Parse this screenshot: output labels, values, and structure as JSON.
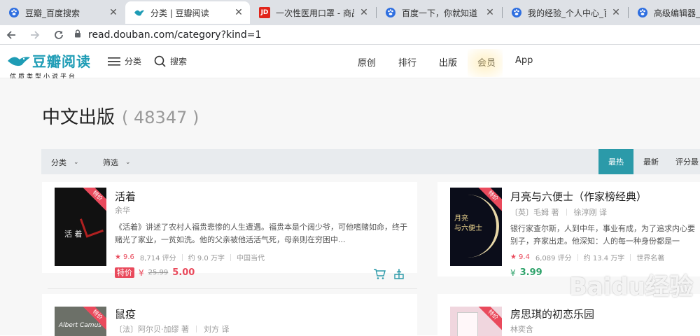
{
  "browser": {
    "tabs": [
      {
        "title": "豆瓣_百度搜索",
        "favicon": "baidu-paw-icon",
        "active": false
      },
      {
        "title": "分类 | 豆瓣阅读",
        "favicon": "douban-read-icon",
        "active": true
      },
      {
        "title": "一次性医用口罩 - 商品搜",
        "favicon": "jd-icon",
        "active": false
      },
      {
        "title": "百度一下，你就知道",
        "favicon": "baidu-paw-icon",
        "active": false
      },
      {
        "title": "我的经验_个人中心_百度",
        "favicon": "baidu-paw-icon",
        "active": false
      },
      {
        "title": "高级编辑器_百度",
        "favicon": "baidu-paw-icon",
        "active": false
      }
    ],
    "jd_favicon_text": "JD",
    "url": "read.douban.com/category?kind=1"
  },
  "site": {
    "brand": "豆瓣阅读",
    "slogan": "优质类型小说平台",
    "category_link": "分类",
    "search_link": "搜索",
    "nav": [
      "原创",
      "排行",
      "出版",
      "会员",
      "App"
    ]
  },
  "page": {
    "title": "中文出版",
    "count": "( 48347 )"
  },
  "filters": {
    "category": "分类",
    "filter": "筛选",
    "sort": [
      {
        "label": "最热",
        "active": true
      },
      {
        "label": "最新",
        "active": false
      },
      {
        "label": "评分最",
        "active": false
      }
    ]
  },
  "books": [
    {
      "title": "活着",
      "author": "余华",
      "ribbon": "特价",
      "cover_text": "活 着",
      "description": "《活着》讲述了农村人福贵悲惨的人生遭遇。福贵本是个阔少爷，可他嗜赌如命，终于赌光了家业，一贫如洗。他的父亲被他活活气死，母亲则在穷困中...",
      "rating": "9.6",
      "rating_count": "8,714 评分",
      "words": "约 9.0 万字",
      "genre": "中国当代",
      "price_tag": "特价",
      "currency": "¥",
      "old_price": "25.99",
      "price": "5.00"
    },
    {
      "title": "月亮与六便士（作家榜经典）",
      "author": "〔英〕毛姆 著",
      "translator": "徐淳刚 译",
      "ribbon": "特价",
      "cover_text": "月亮\n与六便士",
      "description": "银行家查尔斯，人到中年，事业有成，为了追求内心要别子，弃家出走。他深知：人的每一种身份都是一",
      "rating": "9.4",
      "rating_count": "6,089 评分",
      "words": "约 13.4 万字",
      "genre": "世界名著",
      "currency": "¥",
      "price": "3.99"
    },
    {
      "title": "鼠疫",
      "author": "〔法〕阿尔贝·加缪 著",
      "translator": "刘方 译",
      "ribbon": "特价",
      "cover_text": "Albert Camus"
    },
    {
      "title": "房思琪的初恋乐园",
      "author": "林奕含",
      "ribbon": "特价"
    }
  ],
  "watermark": "Baidu经验",
  "colors": {
    "accent": "#2b9aa9",
    "brand": "#1e9cb5",
    "sale": "#e94a5c",
    "green_price": "#2ea26a"
  }
}
